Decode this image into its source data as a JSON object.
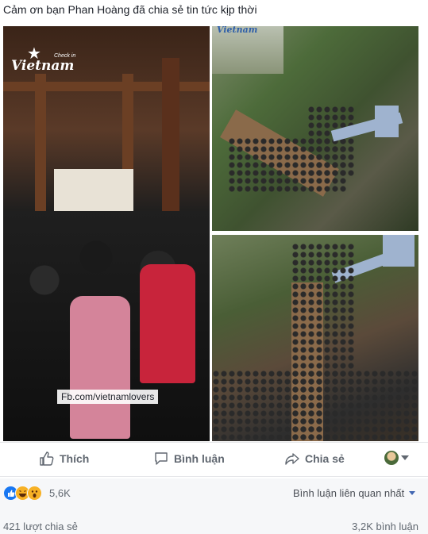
{
  "post": {
    "text": "Cảm ơn bạn Phan Hoàng đã chia sẻ tin tức kịp thời"
  },
  "photos": {
    "left": {
      "watermark_logo": "Vietnam",
      "watermark_sub": "Check in",
      "fb_tag": "Fb.com/vietnamlovers"
    },
    "top_right": {
      "watermark": "Vietnam"
    }
  },
  "actions": {
    "like_label": "Thích",
    "comment_label": "Bình luận",
    "share_label": "Chia sẻ"
  },
  "reactions": {
    "icons": [
      "like-icon",
      "haha-icon",
      "wow-icon"
    ],
    "count": "5,6K",
    "sort_label": "Bình luận liên quan nhất"
  },
  "footer": {
    "shares": "421 lượt chia sẻ",
    "comments": "3,2K bình luận"
  },
  "colors": {
    "like_blue": "#1877f2",
    "link_blue": "#4267b2",
    "muted_text": "#606770"
  }
}
